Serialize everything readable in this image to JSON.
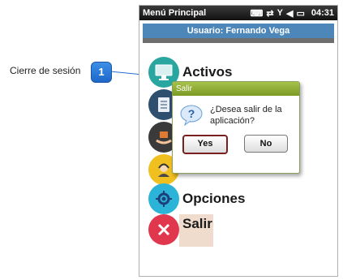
{
  "annotation": {
    "label": "Cierre de sesión",
    "badge": "1"
  },
  "statusbar": {
    "title": "Menú Principal",
    "time": "04:31",
    "icons": [
      "keyboard-icon",
      "sync-icon",
      "no-signal-icon",
      "volume-icon",
      "battery-icon"
    ]
  },
  "user": {
    "label": "Usuario: Fernando Vega"
  },
  "menu": {
    "items": [
      {
        "label": "Activos",
        "icon": "assets-icon",
        "color": "#2aa6a0"
      },
      {
        "label": "",
        "icon": "checklist-icon",
        "color": "#2f4f6e"
      },
      {
        "label": "",
        "icon": "delivery-icon",
        "color": "#3a3a3a"
      },
      {
        "label": "",
        "icon": "support-icon",
        "color": "#f0c020"
      },
      {
        "label": "Opciones",
        "icon": "gear-icon",
        "color": "#1e90c8"
      },
      {
        "label": "Salir",
        "icon": "close-icon",
        "color": "#e0364e"
      }
    ]
  },
  "dialog": {
    "title": "Salir",
    "message": "¿Desea salir de la aplicación?",
    "icon": "question-icon",
    "yes_label": "Yes",
    "no_label": "No"
  }
}
